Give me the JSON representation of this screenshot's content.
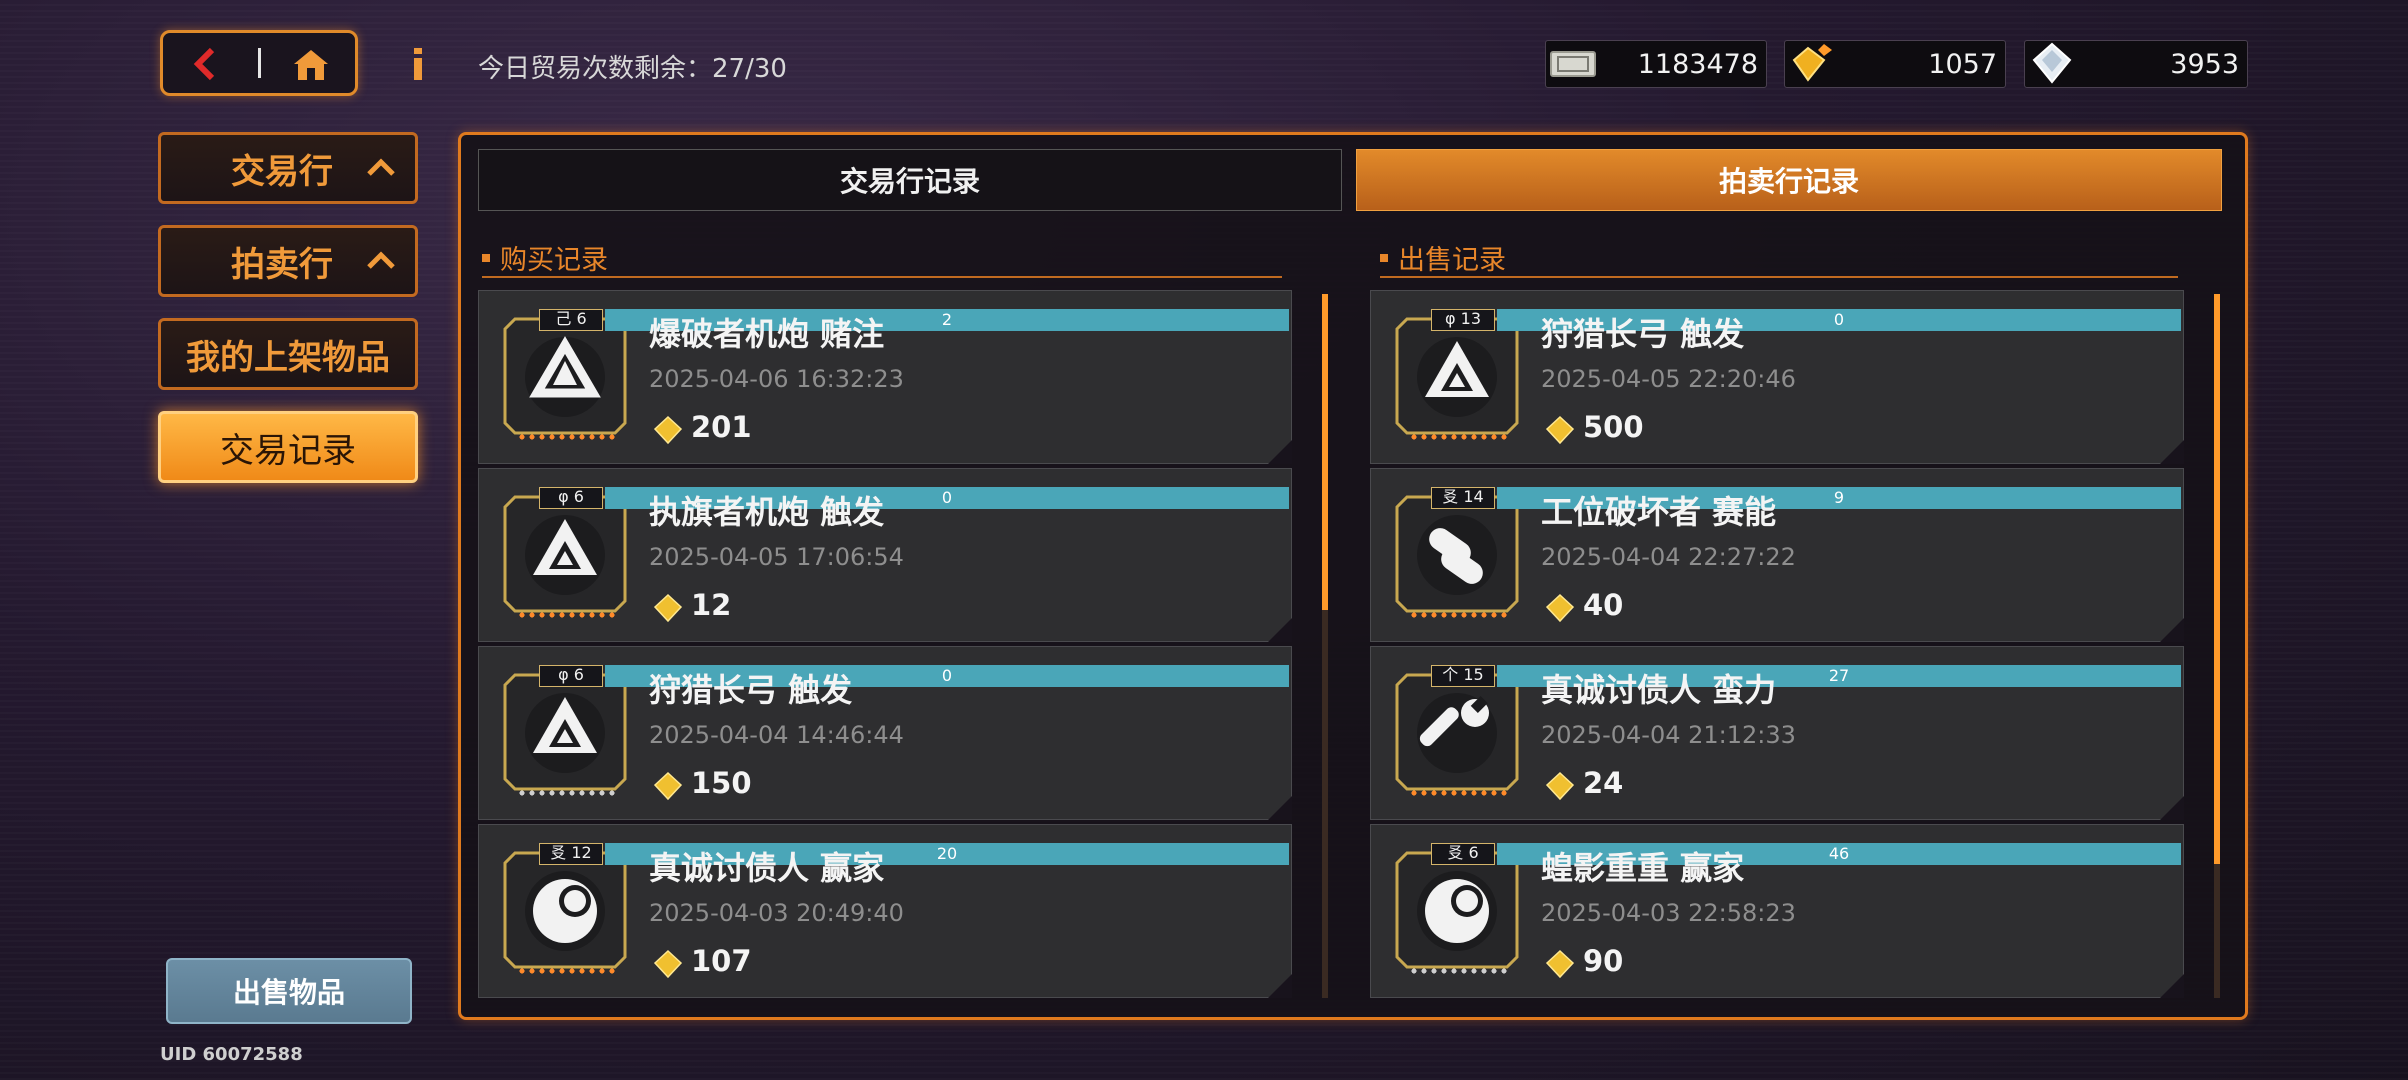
{
  "header": {
    "trade_count_text": "今日贸易次数剩余：27/30",
    "currencies": [
      {
        "icon": "ticket-icon",
        "value": "1183478"
      },
      {
        "icon": "gold-gem-icon",
        "value": "1057"
      },
      {
        "icon": "diamond-icon",
        "value": "3953"
      }
    ]
  },
  "sidebar": {
    "items": [
      {
        "label": "交易行",
        "expanded": true
      },
      {
        "label": "拍卖行",
        "expanded": true
      },
      {
        "label": "我的上架物品"
      },
      {
        "label": "交易记录",
        "active": true
      }
    ],
    "sell_button": "出售物品",
    "uid": "UID 60072588"
  },
  "tabs": [
    {
      "label": "交易行记录",
      "active": false
    },
    {
      "label": "拍卖行记录",
      "active": true
    }
  ],
  "buy_section": {
    "title": "购买记录",
    "records": [
      {
        "name": "爆破者机炮 赌注",
        "date": "2025-04-06 16:32:23",
        "price": "201",
        "tag": "己 6",
        "count": "2",
        "icon": "tri-arrow-icon"
      },
      {
        "name": "执旗者机炮 触发",
        "date": "2025-04-05 17:06:54",
        "price": "12",
        "tag": "φ 6",
        "count": "0",
        "icon": "triangle-icon"
      },
      {
        "name": "狩猎长弓 触发",
        "date": "2025-04-04 14:46:44",
        "price": "150",
        "tag": "φ 6",
        "count": "0",
        "icon": "triangle-icon"
      },
      {
        "name": "真诚讨债人 赢家",
        "date": "2025-04-03 20:49:40",
        "price": "107",
        "tag": "㕛 12",
        "count": "20",
        "icon": "moon-icon"
      }
    ]
  },
  "sell_section": {
    "title": "出售记录",
    "records": [
      {
        "name": "狩猎长弓 触发",
        "date": "2025-04-05 22:20:46",
        "price": "500",
        "tag": "φ 13",
        "count": "0",
        "icon": "triangle-icon"
      },
      {
        "name": "工位破坏者 赛能",
        "date": "2025-04-04 22:27:22",
        "price": "40",
        "tag": "㕛 14",
        "count": "9",
        "icon": "capsule-icon"
      },
      {
        "name": "真诚讨债人 蛮力",
        "date": "2025-04-04 21:12:33",
        "price": "24",
        "tag": "个 15",
        "count": "27",
        "icon": "wrench-icon"
      },
      {
        "name": "蝗影重重 赢家",
        "date": "2025-04-03 22:58:23",
        "price": "90",
        "tag": "㕛 6",
        "count": "46",
        "icon": "moon-icon"
      }
    ]
  },
  "colors": {
    "accent": "#e8862a",
    "card_bg": "#2e2e30",
    "price_gem": "#f0c030",
    "count_badge": "#4aa6b8"
  }
}
